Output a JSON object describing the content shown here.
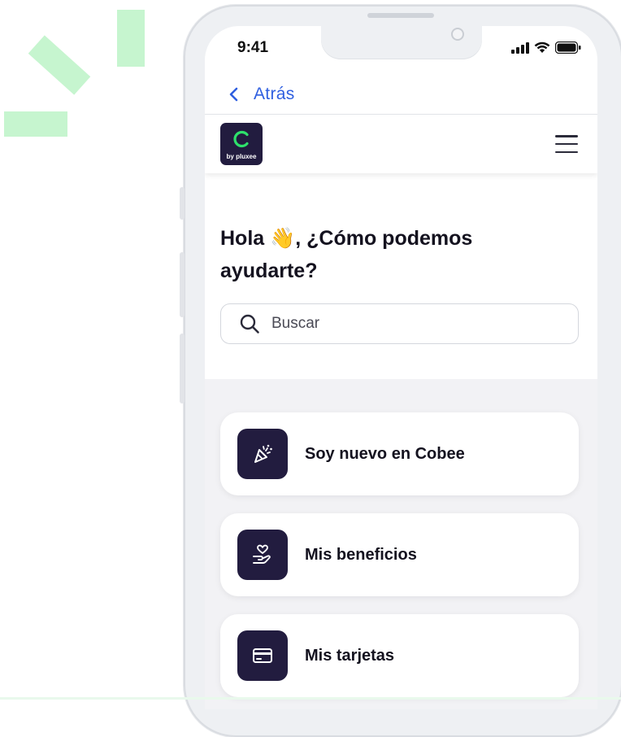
{
  "status_bar": {
    "time": "9:41"
  },
  "nav": {
    "back_label": "Atrás"
  },
  "header": {
    "logo_text": "by pluxee"
  },
  "hero": {
    "title": "Hola 👋, ¿Cómo podemos ayudarte?"
  },
  "search": {
    "placeholder": "Buscar"
  },
  "cards": [
    {
      "label": "Soy nuevo en Cobee",
      "icon": "party-popper-icon"
    },
    {
      "label": "Mis beneficios",
      "icon": "hand-heart-icon"
    },
    {
      "label": "Mis tarjetas",
      "icon": "credit-card-icon"
    }
  ],
  "colors": {
    "brand_dark": "#221c3f",
    "accent_green": "#2ee06b",
    "link_blue": "#2f5fe0",
    "deco_green": "#c6f5cf"
  }
}
